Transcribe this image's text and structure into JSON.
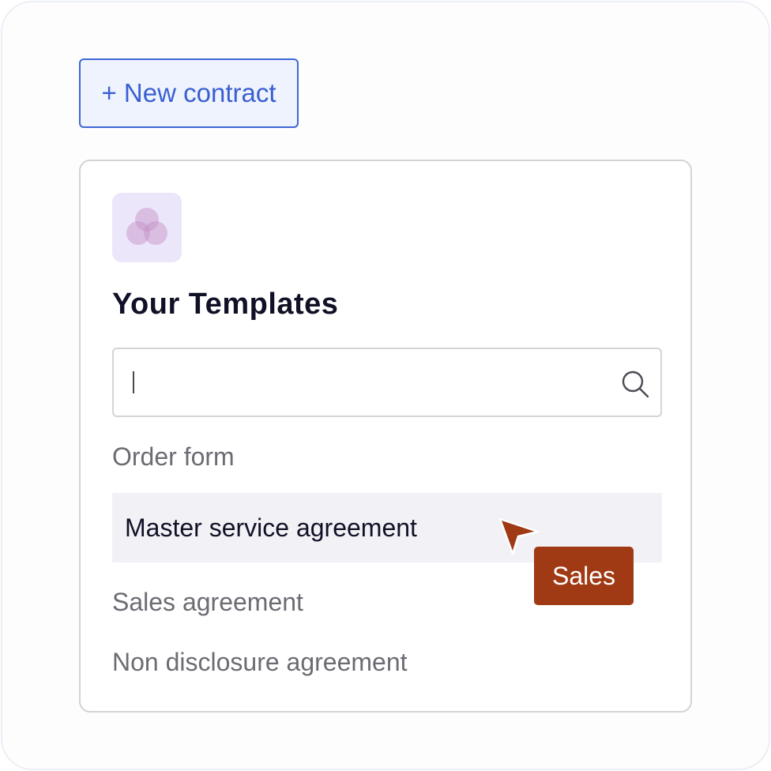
{
  "toolbar": {
    "new_contract_label": "+ New contract"
  },
  "templates": {
    "title": "Your Templates",
    "search": {
      "value": "",
      "icon": "search-icon"
    },
    "items": [
      {
        "label": "Order form",
        "hovered": false
      },
      {
        "label": "Master service agreement",
        "hovered": true
      },
      {
        "label": "Sales agreement",
        "hovered": false
      },
      {
        "label": "Non disclosure agreement",
        "hovered": false
      }
    ]
  },
  "cursor": {
    "tag_label": "Sales",
    "color": "#9f3a14"
  },
  "colors": {
    "accent": "#3a5fd2",
    "button_bg": "#eff3fe",
    "logo_bg": "#ece6fb",
    "hover_bg": "#f2f2f6",
    "cursor_tag": "#9f3a14"
  }
}
